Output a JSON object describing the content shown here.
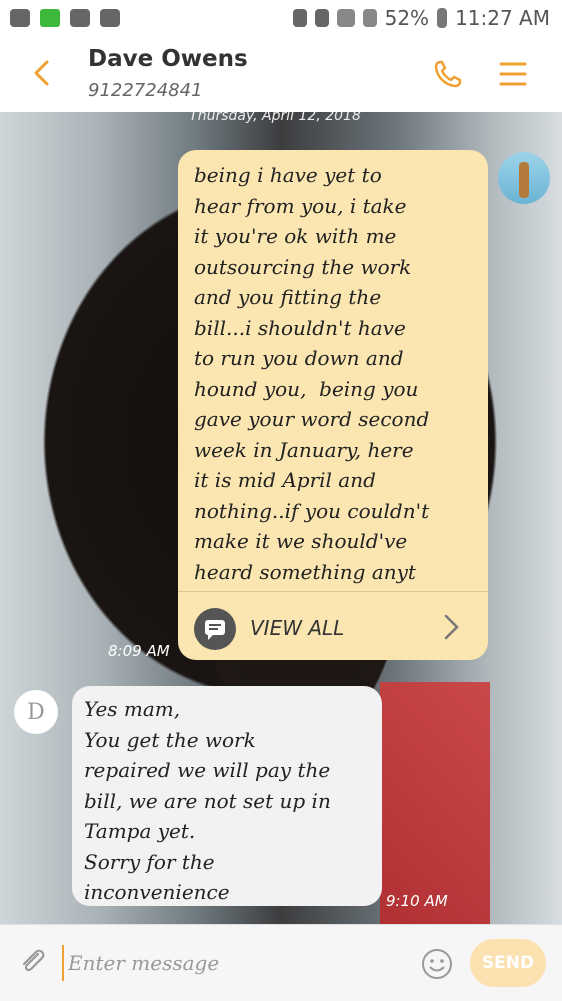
{
  "status_bar": {
    "battery": "52%",
    "time": "11:27 AM"
  },
  "header": {
    "contact_name": "Dave Owens",
    "contact_number": "9122724841"
  },
  "conversation": {
    "date": "Thursday, April 12, 2018",
    "messages": [
      {
        "direction": "outgoing",
        "text": "being i have yet to\nhear from you, i take\nit you're ok with me\noutsourcing the work\nand you fitting the\nbill...i shouldn't have\nto run you down and\nhound you,  being you\ngave your word second\nweek in January, here\nit is mid April and\nnothing..if you couldn't\nmake it we should've\nheard something anyt",
        "view_all_label": "VIEW ALL",
        "time": "8:09 AM"
      },
      {
        "direction": "incoming",
        "avatar_letter": "D",
        "text": "Yes mam,\nYou get the work\nrepaired we will pay the\nbill, we are not set up in\nTampa yet.\nSorry for the\ninconvenience",
        "time": "9:10 AM"
      }
    ]
  },
  "composer": {
    "placeholder": "Enter message",
    "send_label": "SEND"
  },
  "colors": {
    "accent": "#f0a030",
    "outgoing_bubble": "#fbe6b1",
    "incoming_bubble": "#f2f2f2"
  },
  "icons": [
    "back-icon",
    "phone-icon",
    "menu-icon",
    "attachment-icon",
    "emoji-icon",
    "chevron-right-icon",
    "message-icon"
  ]
}
